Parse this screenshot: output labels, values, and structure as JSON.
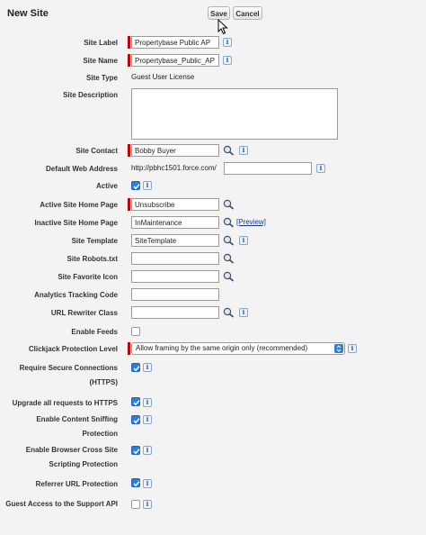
{
  "header": {
    "title": "New Site"
  },
  "toolbar": {
    "save_label": "Save",
    "cancel_label": "Cancel"
  },
  "fields": {
    "site_label": {
      "label": "Site Label",
      "value": "Propertybase Public AP"
    },
    "site_name": {
      "label": "Site Name",
      "value": "Propertybase_Public_AP"
    },
    "site_type": {
      "label": "Site Type",
      "value": "Guest User License"
    },
    "site_description": {
      "label": "Site Description",
      "value": ""
    },
    "site_contact": {
      "label": "Site Contact",
      "value": "Bobby Buyer"
    },
    "default_web_address": {
      "label": "Default Web Address",
      "prefix": "http://pbhc1501.force.com/",
      "value": ""
    },
    "active": {
      "label": "Active",
      "checked": true
    },
    "active_home_page": {
      "label": "Active Site Home Page",
      "value": "Unsubscribe"
    },
    "inactive_home_page": {
      "label": "Inactive Site Home Page",
      "value": "InMaintenance",
      "preview_label": "[Preview]"
    },
    "site_template": {
      "label": "Site Template",
      "value": "SiteTemplate"
    },
    "site_robots": {
      "label": "Site Robots.txt",
      "value": ""
    },
    "site_favorite_icon": {
      "label": "Site Favorite Icon",
      "value": ""
    },
    "analytics_code": {
      "label": "Analytics Tracking Code",
      "value": ""
    },
    "url_rewriter": {
      "label": "URL Rewriter Class",
      "value": ""
    },
    "enable_feeds": {
      "label": "Enable Feeds",
      "checked": false
    },
    "clickjack": {
      "label": "Clickjack Protection Level",
      "value": "Allow framing by the same origin only (recommended)"
    },
    "require_secure": {
      "label": "Require Secure Connections (HTTPS)",
      "checked": true
    },
    "upgrade_https": {
      "label": "Upgrade all requests to HTTPS",
      "checked": true
    },
    "content_sniffing": {
      "label": "Enable Content Sniffing Protection",
      "checked": true
    },
    "cross_site_scripting": {
      "label": "Enable Browser Cross Site Scripting Protection",
      "checked": true
    },
    "referrer_url": {
      "label": "Referrer URL Protection",
      "checked": true
    },
    "guest_access_api": {
      "label": "Guest Access to the Support API",
      "checked": false
    }
  },
  "icons": {
    "info": "info-icon",
    "lookup": "magnifier-lookup-icon",
    "cursor": "mouse-pointer-icon"
  },
  "colors": {
    "required": "#cc0000",
    "checkbox_accent": "#2f7cdb",
    "background": "#f3f3f3"
  },
  "glyphs": {
    "info": "i"
  }
}
